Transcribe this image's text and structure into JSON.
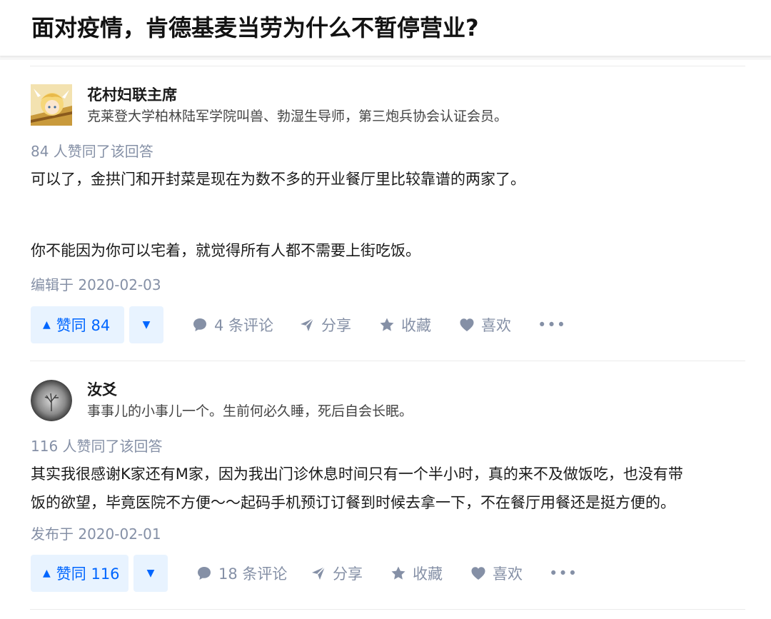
{
  "question": {
    "title": "面对疫情，肯德基麦当劳为什么不暂停营业?"
  },
  "colors": {
    "accent": "#0066ff",
    "accent_bg": "#e8f3ff",
    "meta": "#8590a6"
  },
  "answers": [
    {
      "author": {
        "name": "花村妇联主席",
        "bio": "克莱登大学柏林陆军学院叫兽、勃湿生导师，第三炮兵协会认证会员。",
        "avatar_icon": "anime-avatar"
      },
      "vote_summary": "84 人赞同了该回答",
      "paragraphs": [
        "可以了，金拱门和开封菜是现在为数不多的开业餐厅里比较靠谱的两家了。",
        "你不能因为你可以宅着，就觉得所有人都不需要上街吃饭。"
      ],
      "time": "编辑于 2020-02-03",
      "actions": {
        "upvote": "赞同 84",
        "comments": "4 条评论",
        "share": "分享",
        "collect": "收藏",
        "like": "喜欢"
      }
    },
    {
      "author": {
        "name": "汝爻",
        "bio": "事事儿的小事儿一个。生前何必久睡，死后自会长眠。",
        "avatar_icon": "tree-avatar"
      },
      "vote_summary": "116 人赞同了该回答",
      "paragraphs": [
        "其实我很感谢K家还有M家，因为我出门诊休息时间只有一个半小时，真的来不及做饭吃，也没有带",
        "饭的欲望，毕竟医院不方便～～起码手机预订订餐到时候去拿一下，不在餐厅用餐还是挺方便的。"
      ],
      "time": "发布于 2020-02-01",
      "actions": {
        "upvote": "赞同 116",
        "comments": "18 条评论",
        "share": "分享",
        "collect": "收藏",
        "like": "喜欢"
      }
    }
  ]
}
